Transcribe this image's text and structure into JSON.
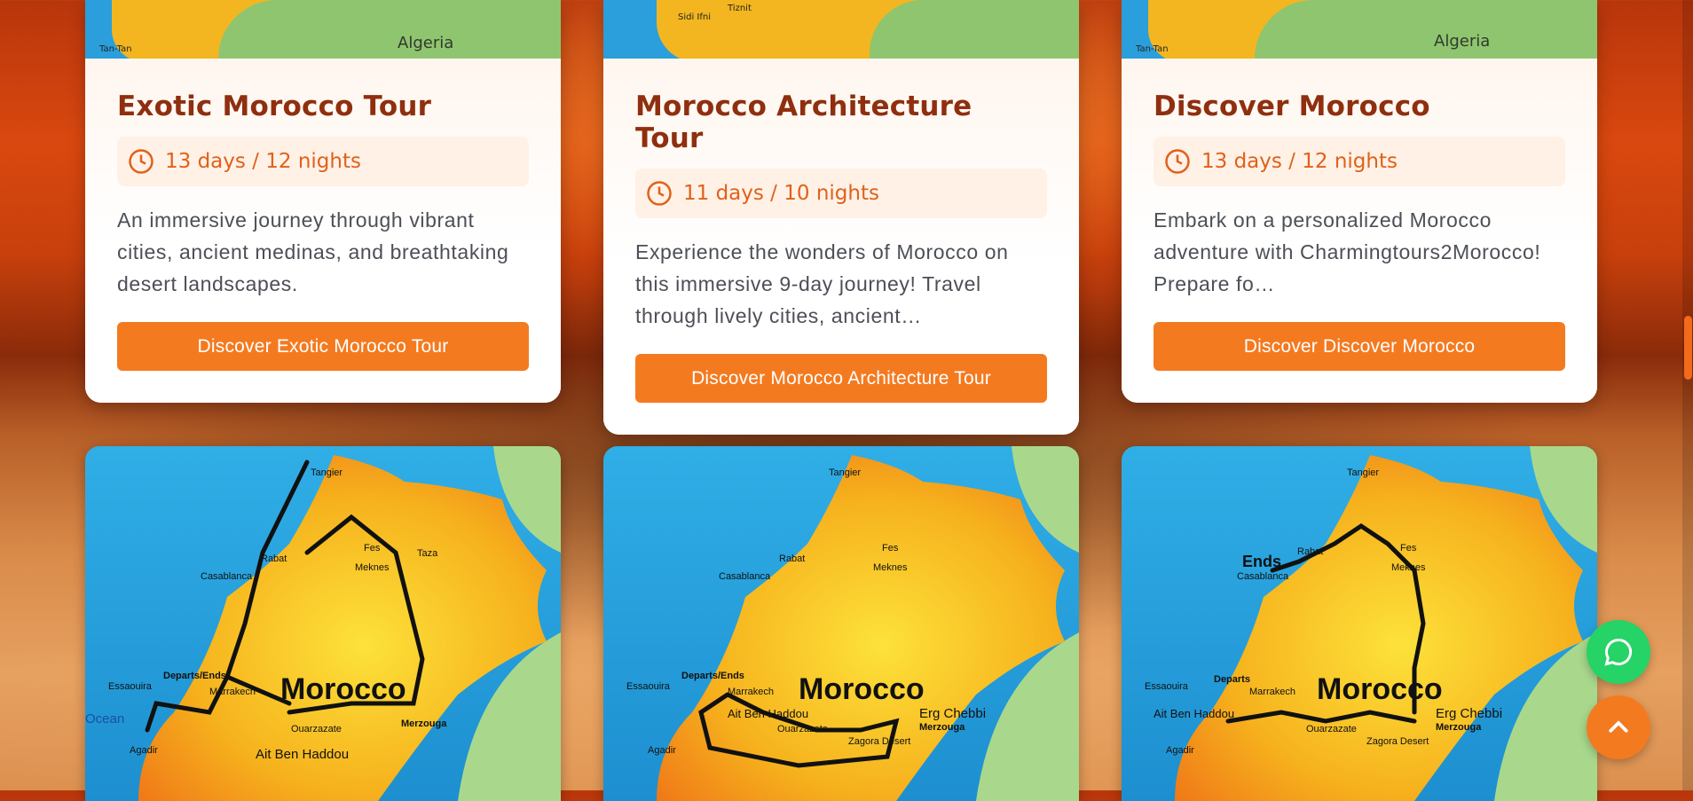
{
  "cards": [
    {
      "title": "Exotic Morocco Tour",
      "duration": "13 days / 12 nights",
      "description": "An immersive journey through vibrant cities, ancient medinas, and breathtaking desert landscapes.",
      "button": "Discover Exotic Morocco Tour",
      "map_labels": [
        "Tan-Tan",
        "Algeria"
      ]
    },
    {
      "title": "Morocco Architecture Tour",
      "duration": "11 days / 10 nights",
      "description": "Experience the wonders of Morocco on this immersive 9-day journey! Travel through lively cities, ancient…",
      "button": "Discover Morocco Architecture Tour",
      "map_labels": [
        "Sidi Ifni",
        "Tiznit"
      ]
    },
    {
      "title": "Discover Morocco",
      "duration": "13 days / 12 nights",
      "description": "Embark on a personalized Morocco adventure with Charmingtours2Morocco! Prepare fo…",
      "button": "Discover Discover Morocco",
      "map_labels": [
        "Tan-Tan",
        "Algeria"
      ]
    }
  ],
  "maps": [
    {
      "title": "Morocco",
      "labels": [
        "Tangier",
        "Departs/Ends",
        "Marrakech",
        "Ouarzazate",
        "Ait Ben Haddou",
        "Merzouga",
        "Casablanca",
        "Rabat",
        "Meknes",
        "Fes",
        "Taza",
        "Essaouira",
        "Agadir",
        "Ocean"
      ]
    },
    {
      "title": "Morocco",
      "labels": [
        "Tangier",
        "Departs/Ends",
        "Marrakech",
        "Ait Ben Haddou",
        "Ouarzazate",
        "Erg Chebbi",
        "Merzouga",
        "Zagora Desert",
        "Casablanca",
        "Rabat",
        "Meknes",
        "Fes",
        "Essaouira",
        "Agadir"
      ]
    },
    {
      "title": "Morocco",
      "labels": [
        "Tangier",
        "Ends",
        "Casablanca",
        "Departs",
        "Marrakech",
        "Ait Ben Haddou",
        "Ouarzazate",
        "Erg Chebbi",
        "Merzouga",
        "Zagora Desert",
        "Rabat",
        "Meknes",
        "Fes",
        "Essaouira",
        "Agadir"
      ]
    }
  ],
  "fab": {
    "chat_icon": "chat-icon",
    "top_icon": "chevron-up-icon"
  },
  "colors": {
    "accent": "#f47a20",
    "title": "#8f2f0f",
    "duration": "#e0611a",
    "whatsapp": "#25d366"
  }
}
